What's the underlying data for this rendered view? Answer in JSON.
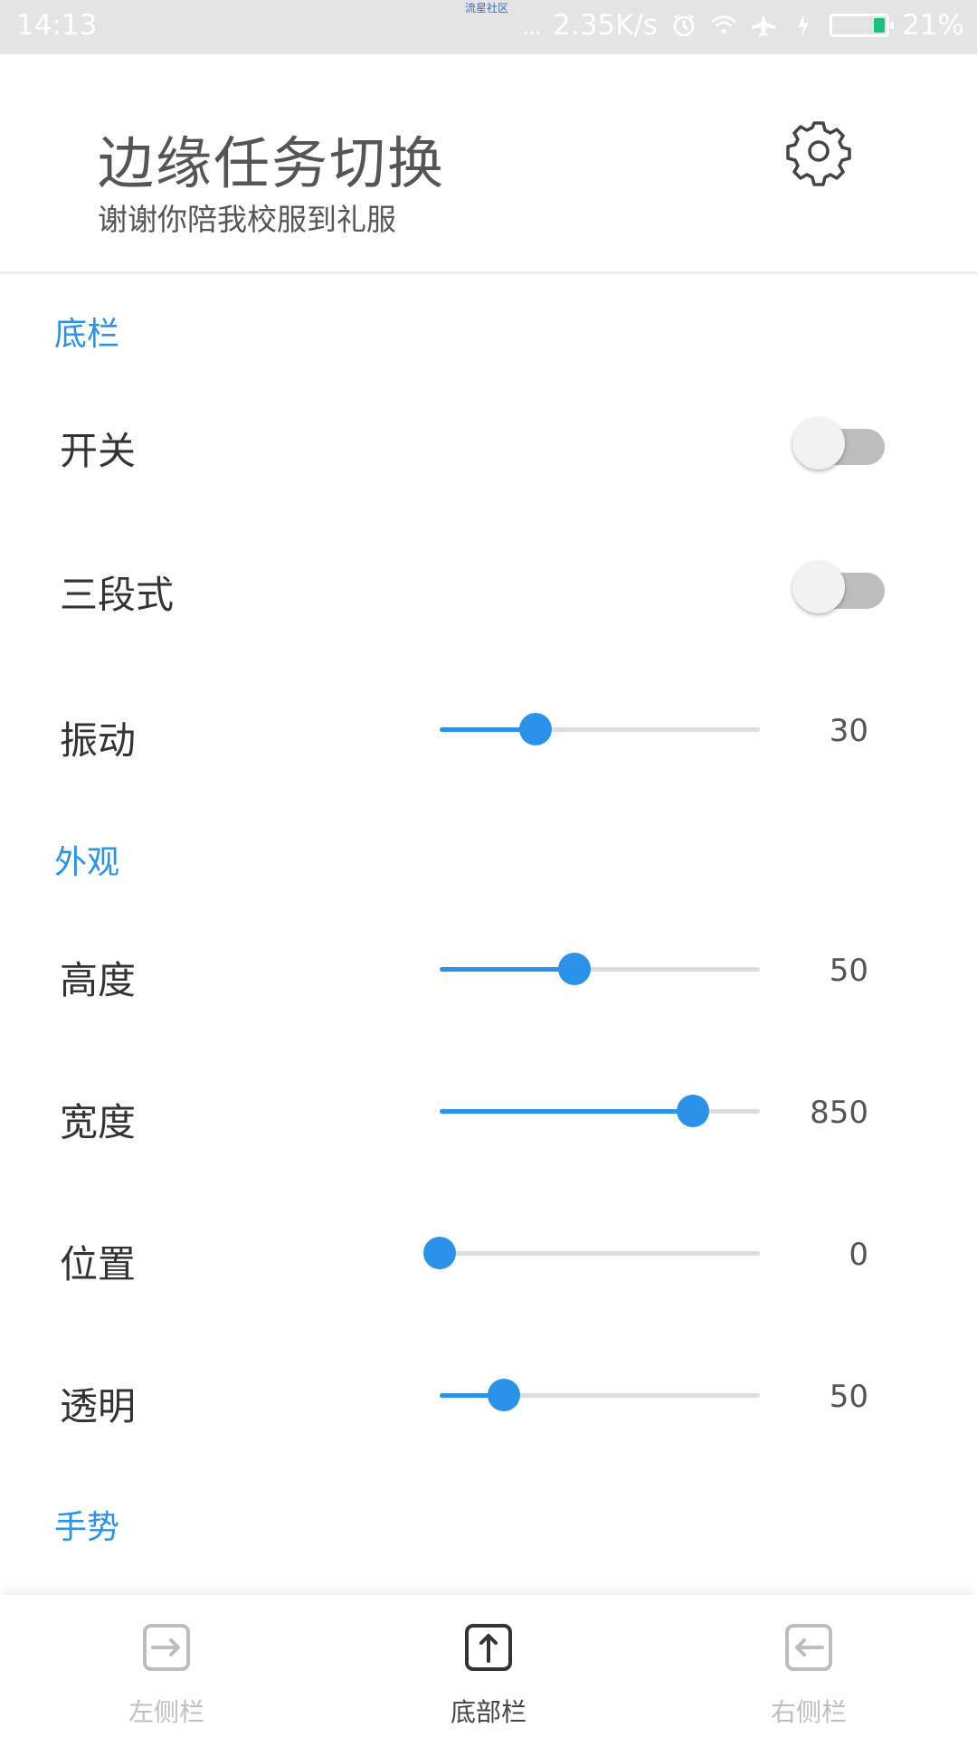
{
  "status_bar": {
    "time": "14:13",
    "carrier": "流星社区",
    "net_dots": "...",
    "speed": "2.35K/s",
    "battery": "21%",
    "icons": [
      "alarm-icon",
      "wifi-icon",
      "airplane-icon",
      "charging-icon",
      "battery-icon"
    ],
    "battery_level": 0.21
  },
  "header": {
    "title": "边缘任务切换",
    "subtitle": "谢谢你陪我校服到礼服",
    "settings_icon": "gear-icon"
  },
  "sections": {
    "bottom_bar": {
      "title": "底栏",
      "toggle_label": "开关",
      "toggle_on": false,
      "three_stage_label": "三段式",
      "three_stage_on": false,
      "vibration_label": "振动",
      "vibration_value": "30",
      "vibration_fraction": 0.3
    },
    "appearance": {
      "title": "外观",
      "height_label": "高度",
      "height_value": "50",
      "height_fraction": 0.42,
      "width_label": "宽度",
      "width_value": "850",
      "width_fraction": 0.79,
      "position_label": "位置",
      "position_value": "0",
      "position_fraction": 0.0,
      "opacity_label": "透明",
      "opacity_value": "50",
      "opacity_fraction": 0.2
    },
    "gesture": {
      "title": "手势"
    }
  },
  "bottom_nav": {
    "items": [
      {
        "label": "左侧栏",
        "icon": "left-panel-icon",
        "active": false
      },
      {
        "label": "底部栏",
        "icon": "bottom-panel-icon",
        "active": true
      },
      {
        "label": "右侧栏",
        "icon": "right-panel-icon",
        "active": false
      }
    ]
  },
  "colors": {
    "accent": "#2b92ea",
    "battery_green": "#19c37d",
    "switch_track": "#bdbdbd"
  }
}
